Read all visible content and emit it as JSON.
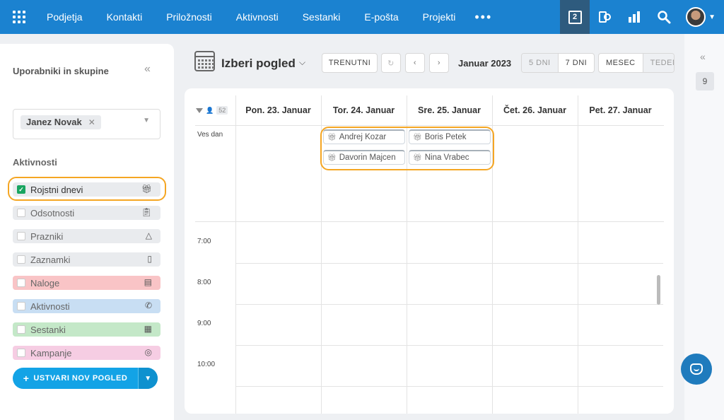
{
  "topbar": {
    "nav": [
      "Podjetja",
      "Kontakti",
      "Priložnosti",
      "Aktivnosti",
      "Sestanki",
      "E-pošta",
      "Projekti"
    ],
    "more": "•••",
    "calendar_day": "2",
    "colors": {
      "bar": "#1b82d0",
      "active": "#2e5b7e"
    }
  },
  "sidebar": {
    "title": "Uporabniki in skupine",
    "selected_user": "Janez Novak",
    "section_title": "Aktivnosti",
    "items": [
      {
        "label": "Rojstni dnevi",
        "checked": true,
        "icon": "gift-icon",
        "color": "#e9ebee"
      },
      {
        "label": "Odsotnosti",
        "checked": false,
        "icon": "clipboard-icon",
        "color": "#e9ebee"
      },
      {
        "label": "Prazniki",
        "checked": false,
        "icon": "tree-icon",
        "color": "#e9ebee"
      },
      {
        "label": "Zaznamki",
        "checked": false,
        "icon": "note-icon",
        "color": "#e9ebee"
      },
      {
        "label": "Naloge",
        "checked": false,
        "icon": "task-icon",
        "color": "#f9c4c6"
      },
      {
        "label": "Aktivnosti",
        "checked": false,
        "icon": "phone-icon",
        "color": "#c8def3"
      },
      {
        "label": "Sestanki",
        "checked": false,
        "icon": "calendar-icon",
        "color": "#c4e8c8"
      },
      {
        "label": "Kampanje",
        "checked": false,
        "icon": "target-icon",
        "color": "#f6cde3"
      }
    ],
    "create_button": "USTVARI NOV POGLED"
  },
  "calendar": {
    "view_title": "Izberi pogled",
    "today_button": "TRENUTNI",
    "month_label": "Januar 2023",
    "range_options": [
      "5 DNI",
      "7 DNI"
    ],
    "view_options": [
      "MESEC",
      "TEDEN"
    ],
    "user_count": "52",
    "days": [
      "Pon. 23. Januar",
      "Tor. 24. Januar",
      "Sre. 25. Januar",
      "Čet. 26. Januar",
      "Pet. 27. Januar"
    ],
    "allday_label": "Ves dan",
    "events": [
      "Andrej Kozar",
      "Boris Petek",
      "Davorin Majcen",
      "Nina Vrabec"
    ],
    "times": [
      "7:00",
      "8:00",
      "9:00",
      "10:00"
    ]
  },
  "right_panel": {
    "count": "9"
  }
}
